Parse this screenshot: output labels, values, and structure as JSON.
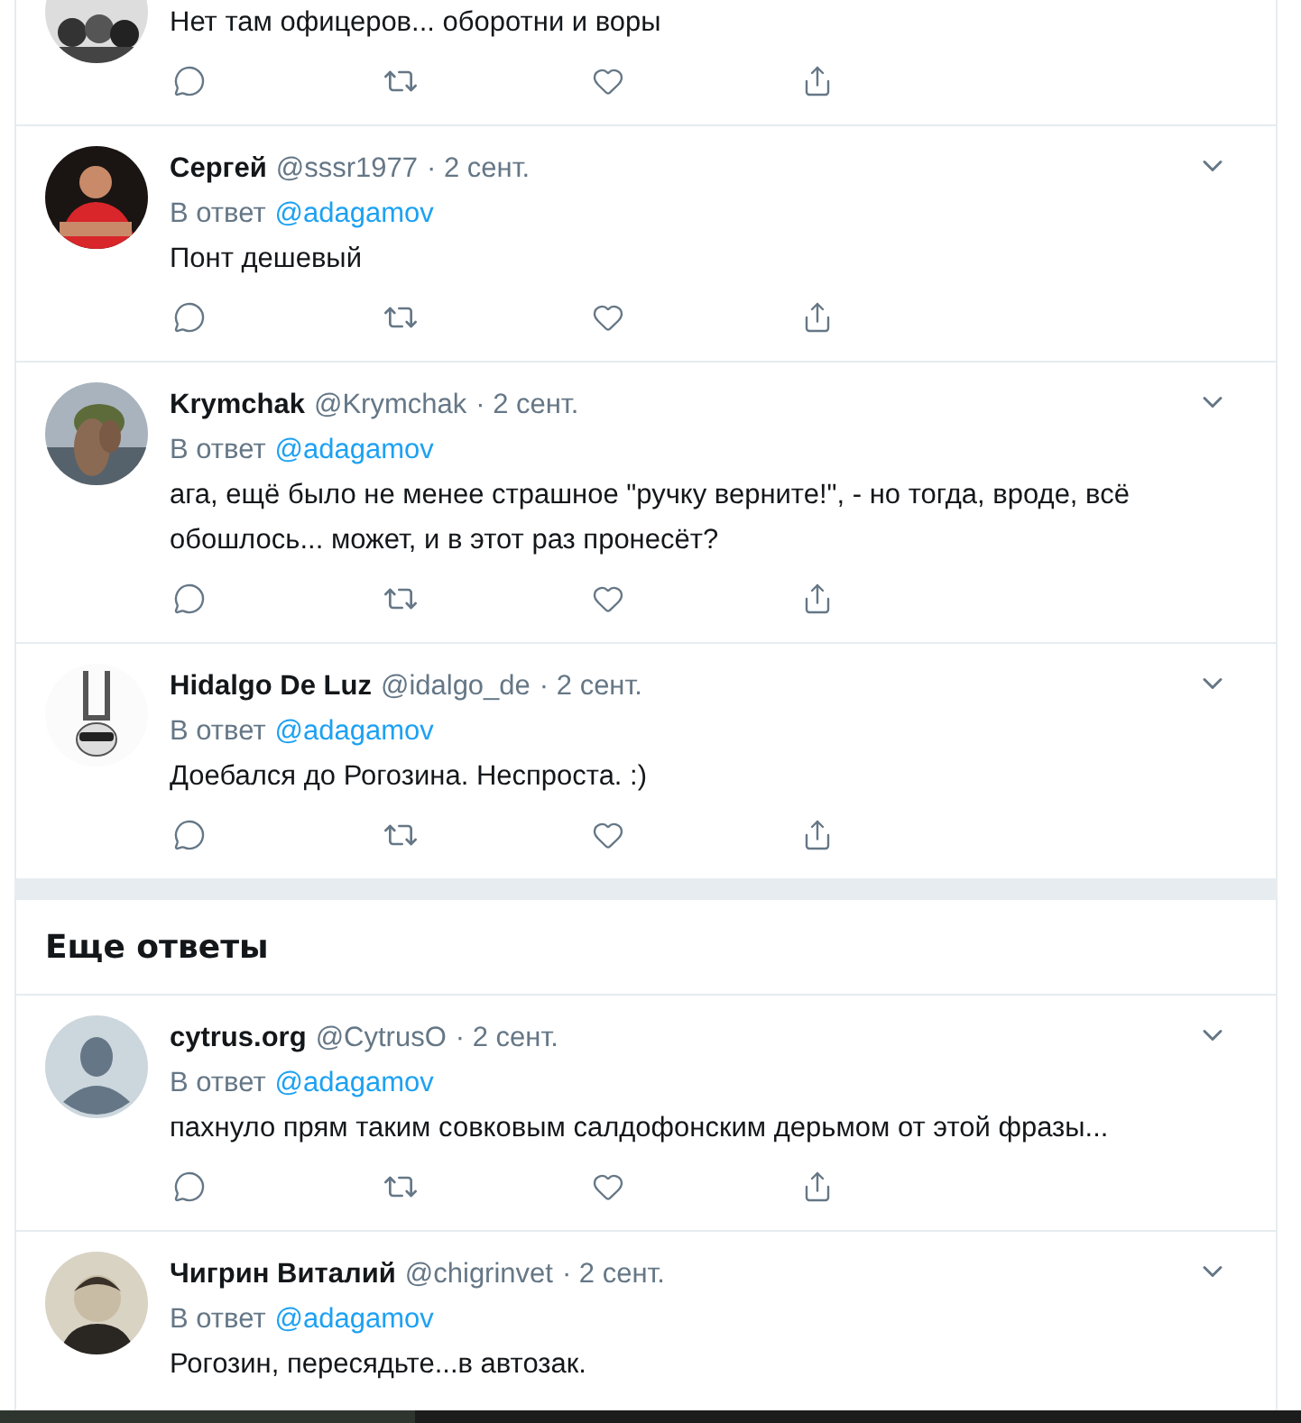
{
  "tweets_top": [
    {
      "avatar": {
        "kind": "group"
      },
      "text": "Нет там офицеров... оборотни и воры"
    },
    {
      "avatar": {
        "kind": "person"
      },
      "name": "Сергей",
      "handle": "@sssr1977",
      "date": "· 2 сент.",
      "reply_prefix": "В ответ",
      "reply_to": "@adagamov",
      "text": "Понт дешевый"
    },
    {
      "avatar": {
        "kind": "animal"
      },
      "name": "Krymchak",
      "handle": "@Krymchak",
      "date": "· 2 сент.",
      "reply_prefix": "В ответ",
      "reply_to": "@adagamov",
      "text": "ага, ещё было не менее страшное \"ручку верните!\", - но тогда, вроде, всё обошлось... может, и в этот раз пронесёт?"
    },
    {
      "avatar": {
        "kind": "emblem"
      },
      "name": "Hidalgo De Luz",
      "handle": "@idalgo_de",
      "date": "· 2 сент.",
      "reply_prefix": "В ответ",
      "reply_to": "@adagamov",
      "text": "Доебался до Рогозина. Неспроста. :)"
    }
  ],
  "more_replies": {
    "title": "Еще ответы",
    "tweets": [
      {
        "avatar": {
          "kind": "default"
        },
        "name": "cytrus.org",
        "handle": "@CytrusO",
        "date": "· 2 сент.",
        "reply_prefix": "В ответ",
        "reply_to": "@adagamov",
        "text": "пахнуло прям таким совковым салдофонским дерьмом от этой фразы..."
      },
      {
        "avatar": {
          "kind": "person-old"
        },
        "name": "Чигрин Виталий",
        "handle": "@chigrinvet",
        "date": "· 2 сент.",
        "reply_prefix": "В ответ",
        "reply_to": "@adagamov",
        "text": "Рогозин, пересядьте...в автозак."
      }
    ]
  }
}
